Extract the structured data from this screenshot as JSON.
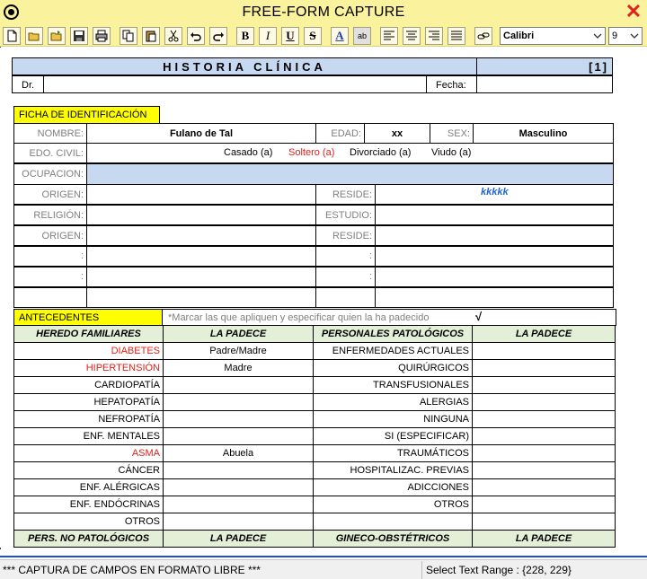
{
  "window": {
    "title": "FREE-FORM CAPTURE"
  },
  "toolbar": {
    "font": "Calibri",
    "size": "9",
    "bold": "B",
    "italic": "I",
    "underline": "U",
    "strike": "S",
    "font_color": "A",
    "highlight": "ab"
  },
  "document": {
    "title": "HISTORIA CLÍNICA",
    "page": "[1]",
    "dr_label": "Dr.",
    "fecha_label": "Fecha:",
    "section_id": "FICHA DE IDENTIFICACIÓN",
    "nombre_label": "NOMBRE:",
    "nombre_value": "Fulano de Tal",
    "edad_label": "EDAD:",
    "edad_value": "xx",
    "sex_label": "SEX:",
    "sex_value": "Masculino",
    "edo_civil_label": "EDO. CIVIL:",
    "civil": {
      "casado": "Casado (a)",
      "soltero": "Soltero (a)",
      "divorciado": "Divorciado (a)",
      "viudo": "Viudo (a)"
    },
    "ocupacion_label": "OCUPACION:",
    "origen_label": "ORIGEN:",
    "reside_label": "RESIDE:",
    "reside_value": "kkkkk",
    "religion_label": "RELIGIÓN:",
    "estudio_label": "ESTUDIO:",
    "origen2_label": "ORIGEN:",
    "reside2_label": "RESIDE:",
    "colon1": ":",
    "colon2": ":",
    "colon3": ":",
    "colon4": ":",
    "section_antecedentes": "ANTECEDENTES",
    "antecedentes_note": "*Marcar las que apliquen y especificar quien la ha padecido",
    "check": "√",
    "col_heredo": "HEREDO FAMILIARES",
    "col_padece": "LA PADECE",
    "col_personales": "PERSONALES PATOLÓGICOS",
    "col_padece2": "LA PADECE",
    "heredo": [
      {
        "name": "DIABETES",
        "value": "Padre/Madre"
      },
      {
        "name": "HIPERTENSIÓN",
        "value": "Madre"
      },
      {
        "name": "CARDIOPATÍA",
        "value": ""
      },
      {
        "name": "HEPATOPATÍA",
        "value": ""
      },
      {
        "name": "NEFROPATÍA",
        "value": ""
      },
      {
        "name": "ENF. MENTALES",
        "value": ""
      },
      {
        "name": "ASMA",
        "value": "Abuela"
      },
      {
        "name": "CÁNCER",
        "value": ""
      },
      {
        "name": "ENF. ALÉRGICAS",
        "value": ""
      },
      {
        "name": "ENF. ENDÓCRINAS",
        "value": ""
      },
      {
        "name": "OTROS",
        "value": ""
      }
    ],
    "personales": [
      "ENFERMEDADES ACTUALES",
      "QUIRÚRGICOS",
      "TRANSFUSIONALES",
      "ALERGIAS",
      "NINGUNA",
      "SI (ESPECIFICAR)",
      "TRAUMÁTICOS",
      "HOSPITALIZAC. PREVIAS",
      "ADICCIONES",
      "OTROS",
      ""
    ],
    "foot_col1": "PERS. NO PATOLÓGICOS",
    "foot_col2": "LA PADECE",
    "foot_col3": "GINECO-OBSTÉTRICOS",
    "foot_col4": "LA PADECE"
  },
  "status": {
    "left": "***  CAPTURA DE CAMPOS EN FORMATO LIBRE  ***",
    "right": "Select Text Range :  {228, 229}"
  },
  "colors": {
    "header_blue": "#c6d9f1",
    "section_yellow": "#ffff00",
    "table_green": "#e4efd8",
    "accent_red": "#e0201a",
    "value_blue": "#1f66c8"
  }
}
